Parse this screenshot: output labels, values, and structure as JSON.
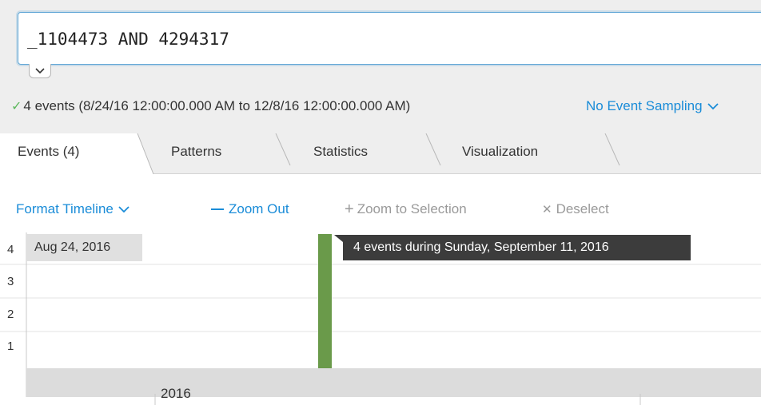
{
  "search": {
    "query": "_1104473 AND 4294317"
  },
  "status": {
    "summary": "4 events (8/24/16 12:00:00.000 AM to 12/8/16 12:00:00.000 AM)",
    "sampling": "No Event Sampling"
  },
  "tabs": [
    {
      "label": "Events (4)",
      "active": true
    },
    {
      "label": "Patterns",
      "active": false
    },
    {
      "label": "Statistics",
      "active": false
    },
    {
      "label": "Visualization",
      "active": false
    }
  ],
  "timeline_toolbar": {
    "format": "Format Timeline",
    "zoom_out": "Zoom Out",
    "zoom_to_selection": "Zoom to Selection",
    "deselect": "Deselect"
  },
  "chart_data": {
    "type": "bar",
    "x": [
      "Sep 11, 2016"
    ],
    "values": [
      4
    ],
    "ylim": [
      0,
      4
    ],
    "yticks": [
      "4",
      "3",
      "2",
      "1"
    ],
    "range_start_label": "Aug 24, 2016",
    "tooltip": "4 events during Sunday, September 11, 2016",
    "year_label": "2016",
    "bar_color": "#6a9a4a",
    "grid": true
  },
  "colors": {
    "accent": "#1a8cd8",
    "success": "#5cb85c",
    "bar": "#6a9a4a"
  }
}
